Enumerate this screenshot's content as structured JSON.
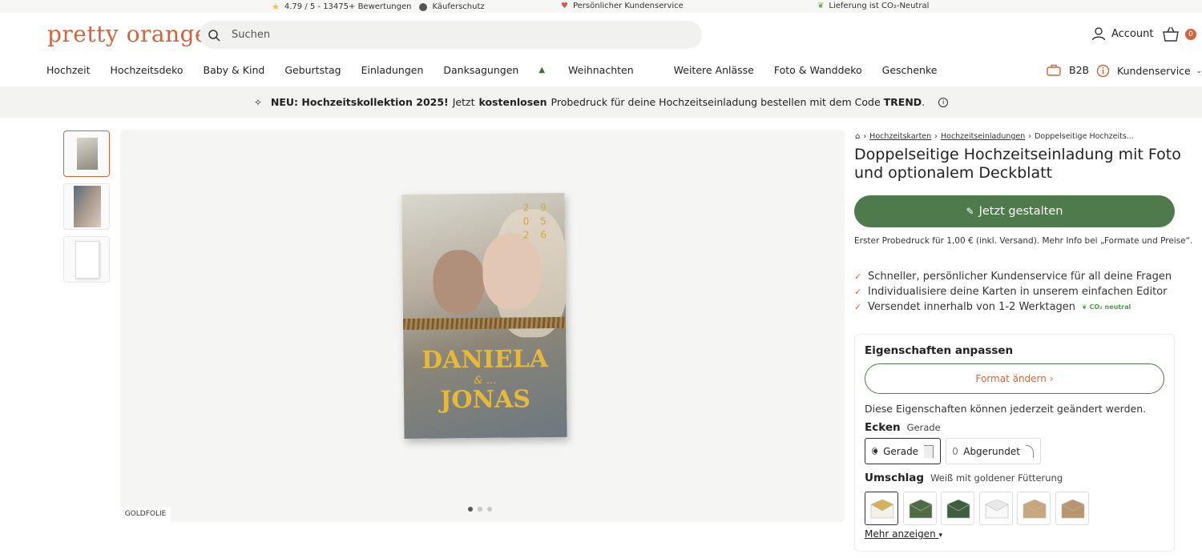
{
  "topbar": {
    "rating": "4.79 / 5 - 13475+ Bewertungen",
    "buyer_protection": "Käuferschutz",
    "service": "Persönlicher Kundenservice",
    "co2": "Lieferung ist CO₂-Neutral"
  },
  "header": {
    "logo": "pretty orange",
    "search_placeholder": "Suchen",
    "account_label": "Account",
    "cart_count": "0"
  },
  "nav": {
    "items": [
      "Hochzeit",
      "Hochzeitsdeko",
      "Baby & Kind",
      "Geburtstag",
      "Einladungen",
      "Danksagungen",
      "Weihnachten",
      "Weitere Anlässe",
      "Foto & Wanddeko",
      "Geschenke"
    ],
    "b2b": "B2B",
    "service": "Kundenservice"
  },
  "promo": {
    "part1": "NEU: Hochzeitskollektion 2025!",
    "part2": "Jetzt",
    "part3": "kostenlosen",
    "part4": "Probedruck für deine Hochzeitseinladung bestellen mit dem Code",
    "code": "TREND",
    "period": "."
  },
  "gallery": {
    "card_date": [
      "2 9",
      "0 5",
      "2 6"
    ],
    "name1": "DANIELA",
    "amp": "& ...",
    "name2": "JONAS",
    "finish_label": "GOLDFOLIE",
    "slide_active": 1,
    "slide_count": 3
  },
  "product": {
    "breadcrumb": [
      "Hochzeitskarten",
      "Hochzeitseinladungen",
      "Doppelseitige Hochzeits..."
    ],
    "title": "Doppelseitige Hochzeitseinladung mit Foto und optionalem Deckblatt",
    "cta": "Jetzt gestalten",
    "probe_note": "Erster Probedruck für 1,00 € (inkl. Versand). Mehr Info bei „Formate und Preise“.",
    "benefits": [
      "Schneller, persönlicher Kundenservice für all deine Fragen",
      "Individualisiere deine Karten in unserem einfachen Editor",
      "Versendet innerhalb von 1-2 Werktagen"
    ],
    "co2_badge": "CO₂ neutral"
  },
  "properties": {
    "heading": "Eigenschaften anpassen",
    "format_button": "Format ändern ›",
    "note": "Diese Eigenschaften können jederzeit geändert werden.",
    "corners_label": "Ecken",
    "corners_value": "Gerade",
    "corner_options": [
      "Gerade",
      "Abgerundet"
    ],
    "envelope_label": "Umschlag",
    "envelope_value": "Weiß mit goldener Fütterung",
    "envelope_colors": [
      "#f4f1ea",
      "#4f6b44",
      "#3f5e3f",
      "#f7f7f7",
      "#c9a77d",
      "#b9956e"
    ],
    "more": "Mehr anzeigen"
  },
  "colors": {
    "brand": "#d2643c",
    "green": "#4e7a4c"
  }
}
